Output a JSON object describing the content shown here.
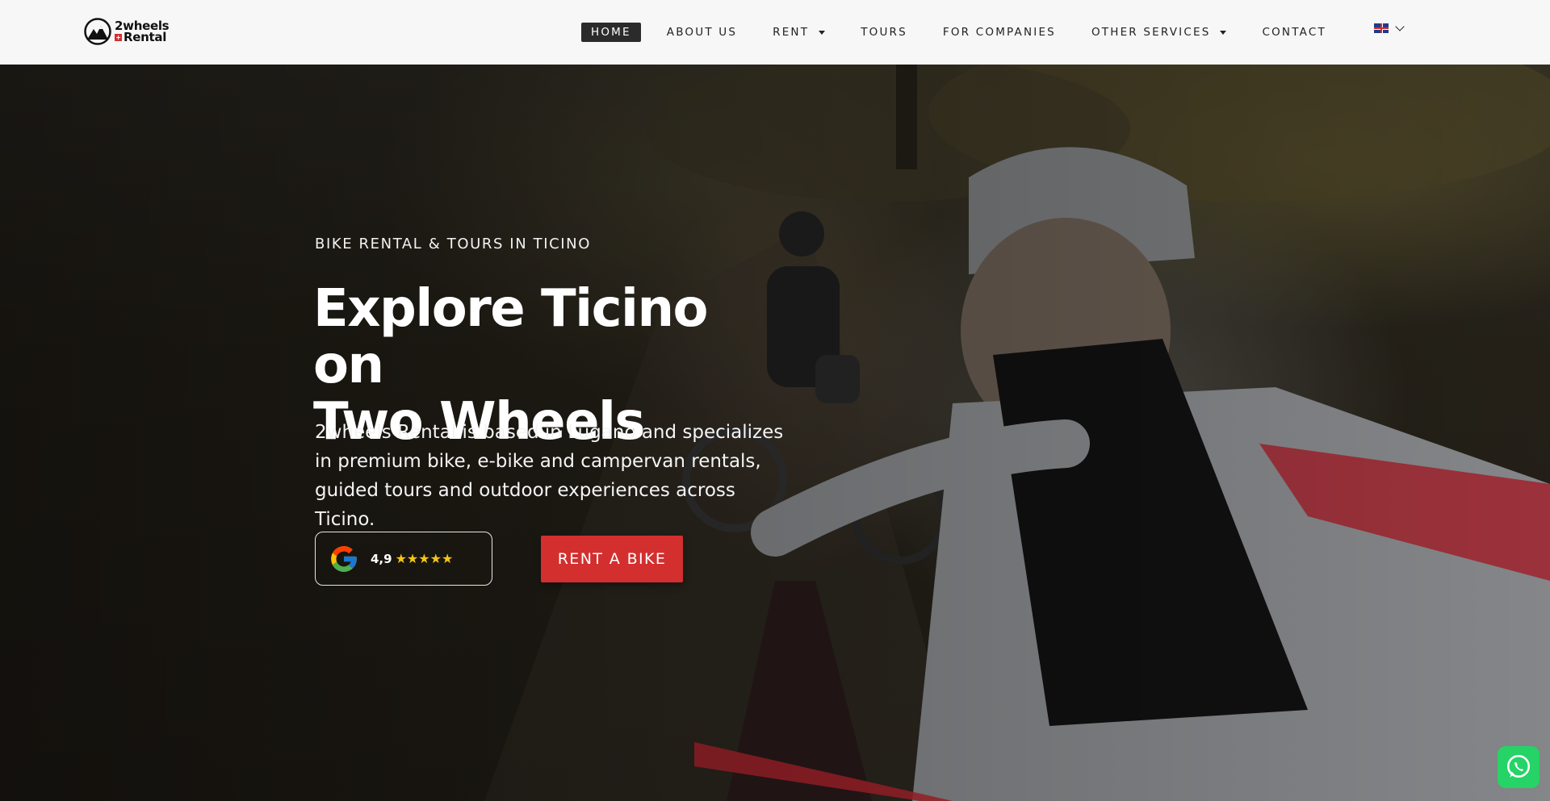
{
  "header": {
    "logo": {
      "line1": "2wheels",
      "line2": "Rental",
      "flag_glyph": "+"
    },
    "nav": [
      {
        "label": "HOME",
        "active": true,
        "has_dropdown": false
      },
      {
        "label": "ABOUT US",
        "active": false,
        "has_dropdown": false
      },
      {
        "label": "RENT",
        "active": false,
        "has_dropdown": true
      },
      {
        "label": "TOURS",
        "active": false,
        "has_dropdown": false
      },
      {
        "label": "FOR COMPANIES",
        "active": false,
        "has_dropdown": false
      },
      {
        "label": "OTHER SERVICES",
        "active": false,
        "has_dropdown": true
      },
      {
        "label": "CONTACT",
        "active": false,
        "has_dropdown": false
      }
    ],
    "language": {
      "icon": "uk-flag-icon"
    }
  },
  "hero": {
    "eyebrow": "BIKE RENTAL & TOURS IN TICINO",
    "headline_line1": "Explore Ticino on",
    "headline_line2": "Two Wheels",
    "lead": "2wheels Rental is based in Lugano and specializes in premium bike, e-bike and campervan rentals, guided tours and outdoor experiences across Ticino.",
    "review": {
      "rating": "4,9",
      "stars": "★★★★★",
      "icon": "google-icon"
    },
    "cta_label": "RENT A BIKE"
  },
  "colors": {
    "accent": "#d32f2f",
    "header_bg": "#f7f7f7",
    "nav_active_bg": "#2b2b2b",
    "star": "#f5c518",
    "whatsapp": "#25d366"
  },
  "floating": {
    "whatsapp_icon": "whatsapp-icon"
  }
}
